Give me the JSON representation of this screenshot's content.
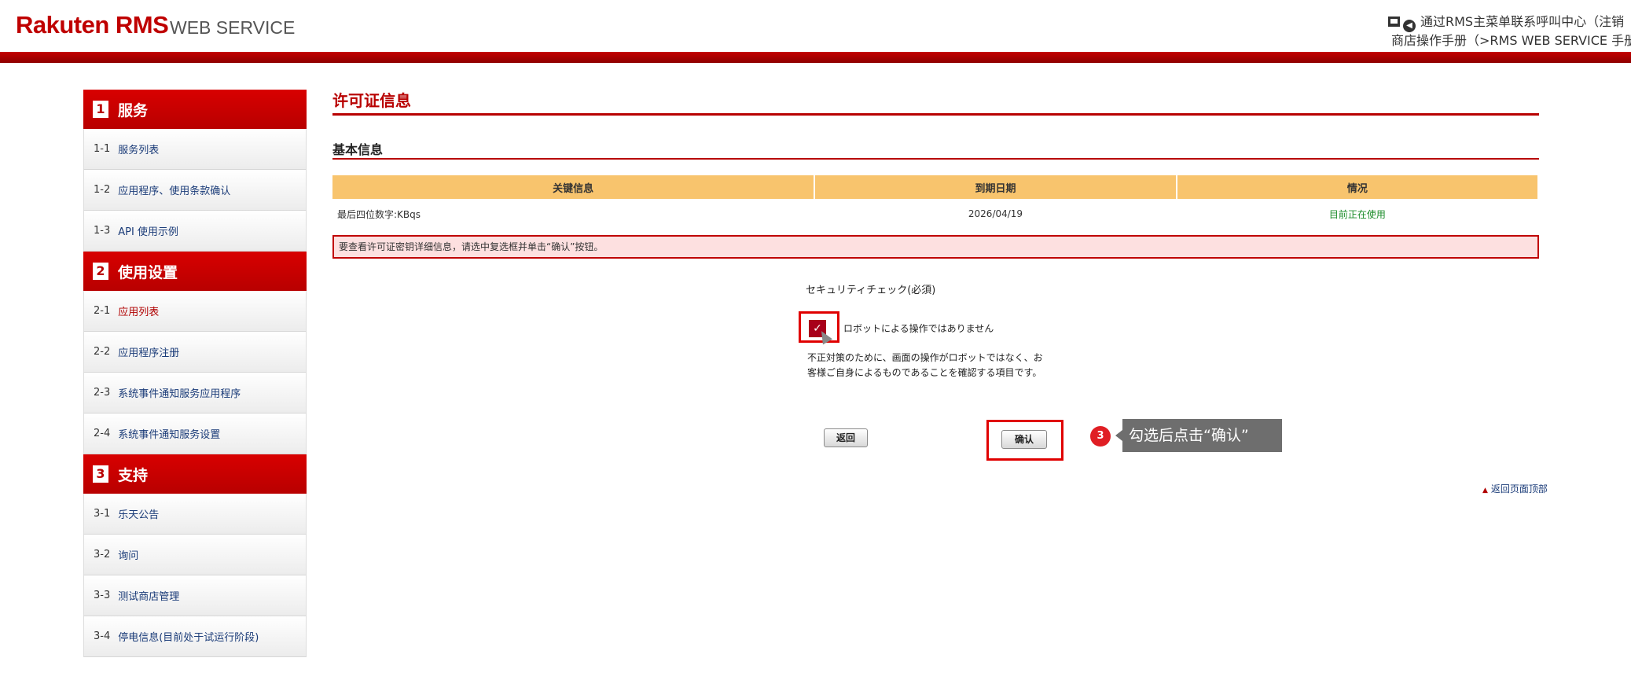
{
  "header": {
    "logo_main": "Rakuten RMS",
    "logo_sub": "WEB SERVICE",
    "contact_link": "通过RMS主菜单联系呼叫中心（注销",
    "manual_link": "商店操作手册（>RMS WEB SERVICE 手册"
  },
  "sidebar": {
    "sections": [
      {
        "num": "1",
        "title": "服务",
        "items": [
          {
            "code": "1-1",
            "label": "服务列表"
          },
          {
            "code": "1-2",
            "label": "应用程序、使用条款确认"
          },
          {
            "code": "1-3",
            "label": "API 使用示例"
          }
        ]
      },
      {
        "num": "2",
        "title": "使用设置",
        "items": [
          {
            "code": "2-1",
            "label": "应用列表"
          },
          {
            "code": "2-2",
            "label": "应用程序注册"
          },
          {
            "code": "2-3",
            "label": "系统事件通知服务应用程序"
          },
          {
            "code": "2-4",
            "label": "系统事件通知服务设置"
          }
        ]
      },
      {
        "num": "3",
        "title": "支持",
        "items": [
          {
            "code": "3-1",
            "label": "乐天公告"
          },
          {
            "code": "3-2",
            "label": "询问"
          },
          {
            "code": "3-3",
            "label": "测试商店管理"
          },
          {
            "code": "3-4",
            "label": "停电信息(目前处于试运行阶段)"
          }
        ]
      }
    ]
  },
  "main": {
    "page_title": "许可证信息",
    "section_title": "基本信息",
    "table": {
      "headers": [
        "关键信息",
        "到期日期",
        "情况"
      ],
      "rows": [
        [
          "最后四位数字:KBqs",
          "2026/04/19",
          "目前正在使用"
        ]
      ]
    },
    "notice": "要查看许可证密钥详细信息，请选中复选框并单击“确认”按钮。",
    "security_check_title": "セキュリティチェック(必須)",
    "checkbox_label": "ロボットによる操作ではありません",
    "checkbox_checked": true,
    "description_line1": "不正対策のために、画面の操作がロボットではなく、お",
    "description_line2": "客様ご自身によるものであることを確認する項目です。",
    "back_button": "返回",
    "confirm_button": "确认",
    "back_to_top": "返回页面顶部"
  },
  "annotation": {
    "step_number": "3",
    "tooltip": "勾选后点击“确认”"
  },
  "colors": {
    "brand_red": "#bf0000",
    "table_header": "#f8c46d",
    "notice_bg": "#fde0e0",
    "status_green": "#1b8c2a"
  }
}
